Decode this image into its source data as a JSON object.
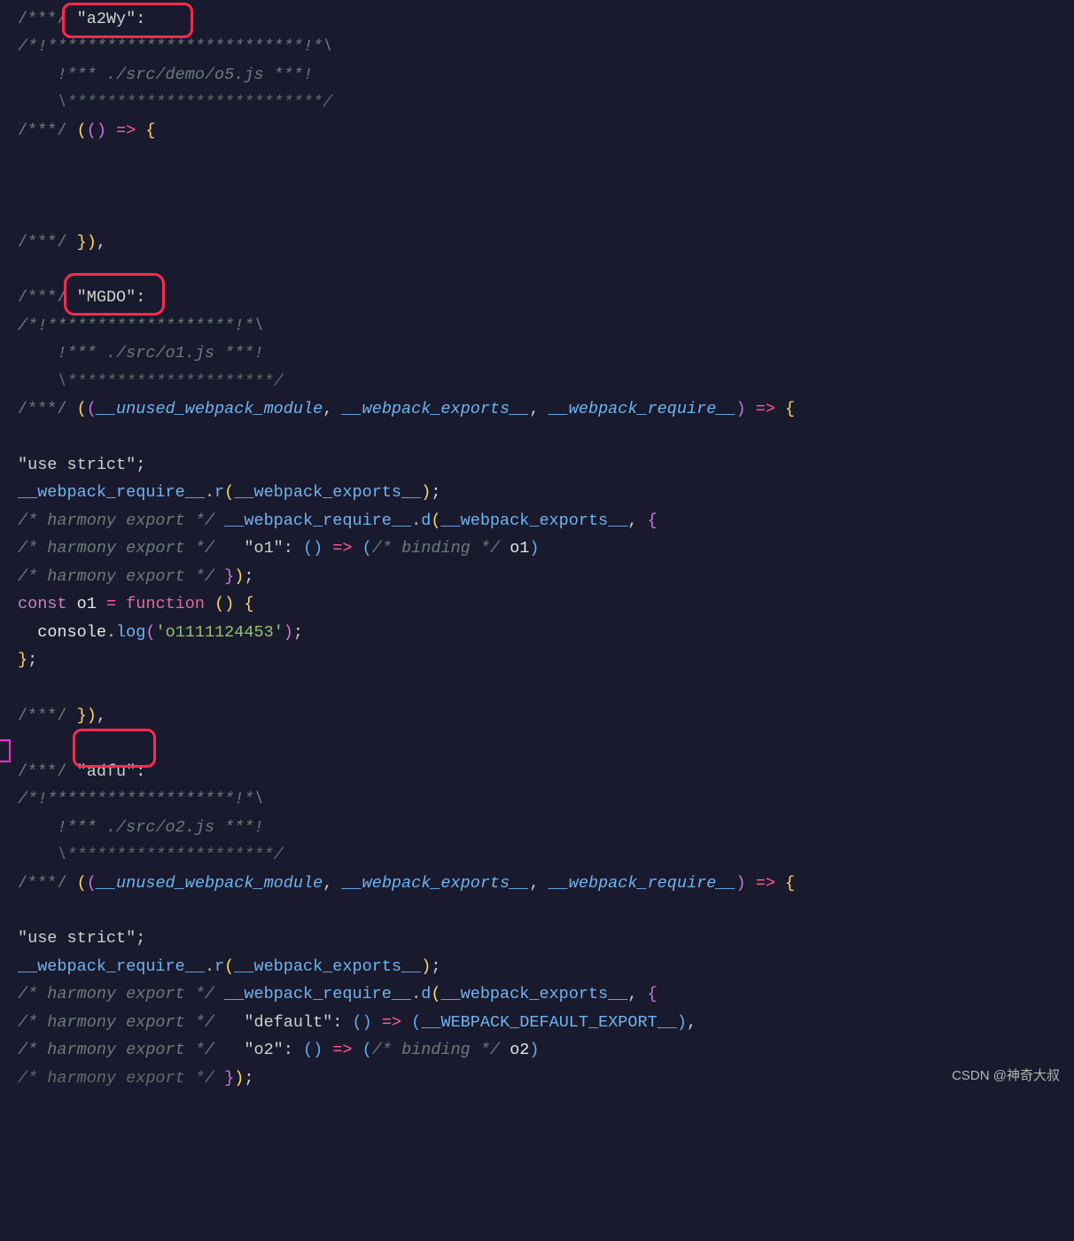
{
  "watermark": "CSDN @神奇大叔",
  "code": {
    "modules": [
      {
        "id": "a2Wy",
        "header": {
          "line1": "/*!**************************!*\\",
          "line2": "  !*** ./src/demo/o5.js ***!",
          "line3": "  \\**************************/"
        },
        "signature": "/***/ (() => {",
        "body": [],
        "closing": "/***/ }),"
      },
      {
        "id": "MGDO",
        "header": {
          "line1": "/*!*******************!*\\",
          "line2": "  !*** ./src/o1.js ***!",
          "line3": "  \\*********************/"
        },
        "signature": "/***/ ((__unused_webpack_module, __webpack_exports__, __webpack_require__) => {",
        "body": [
          "\"use strict\";",
          "__webpack_require__.r(__webpack_exports__);",
          "/* harmony export */ __webpack_require__.d(__webpack_exports__, {",
          "/* harmony export */   \"o1\": () => (/* binding */ o1)",
          "/* harmony export */ });",
          "const o1 = function () {",
          "  console.log('o1111124453');",
          "};"
        ],
        "closing": "/***/ }),"
      },
      {
        "id": "adfu",
        "header": {
          "line1": "/*!*******************!*\\",
          "line2": "  !*** ./src/o2.js ***!",
          "line3": "  \\*********************/"
        },
        "signature": "/***/ ((__unused_webpack_module, __webpack_exports__, __webpack_require__) => {",
        "body": [
          "\"use strict\";",
          "__webpack_require__.r(__webpack_exports__);",
          "/* harmony export */ __webpack_require__.d(__webpack_exports__, {",
          "/* harmony export */   \"default\": () => (__WEBPACK_DEFAULT_EXPORT__),",
          "/* harmony export */   \"o2\": () => (/* binding */ o2)",
          "/* harmony export */ });"
        ]
      }
    ]
  },
  "labels": {
    "marker": "/***/",
    "colon": ":"
  }
}
